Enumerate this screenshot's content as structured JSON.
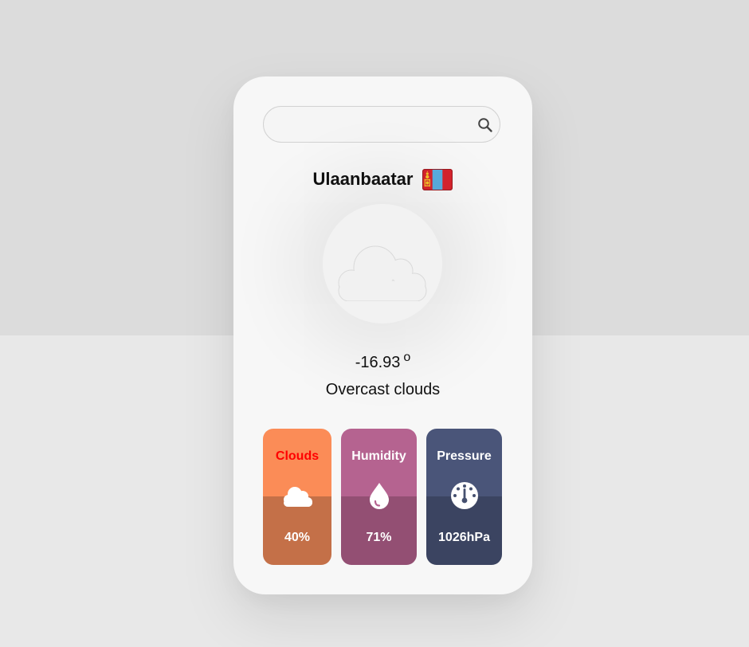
{
  "search": {
    "value": "",
    "placeholder": ""
  },
  "location": {
    "city": "Ulaanbaatar",
    "flag_icon": "mongolia-flag-icon"
  },
  "current": {
    "icon": "overcast-cloud-icon",
    "temperature": "-16.93",
    "temperature_unit": "o",
    "description": "Overcast clouds"
  },
  "stats": {
    "clouds": {
      "label": "Clouds",
      "value": "40%",
      "icon": "cloud-icon",
      "label_color": "#ff0000",
      "color_top": "#fb8c57",
      "color_bottom": "#c47048"
    },
    "humidity": {
      "label": "Humidity",
      "value": "71%",
      "icon": "droplet-icon",
      "color_top": "#b56390",
      "color_bottom": "#934f73"
    },
    "pressure": {
      "label": "Pressure",
      "value": "1026hPa",
      "icon": "gauge-icon",
      "color_top": "#4a5579",
      "color_bottom": "#3b4461"
    }
  }
}
